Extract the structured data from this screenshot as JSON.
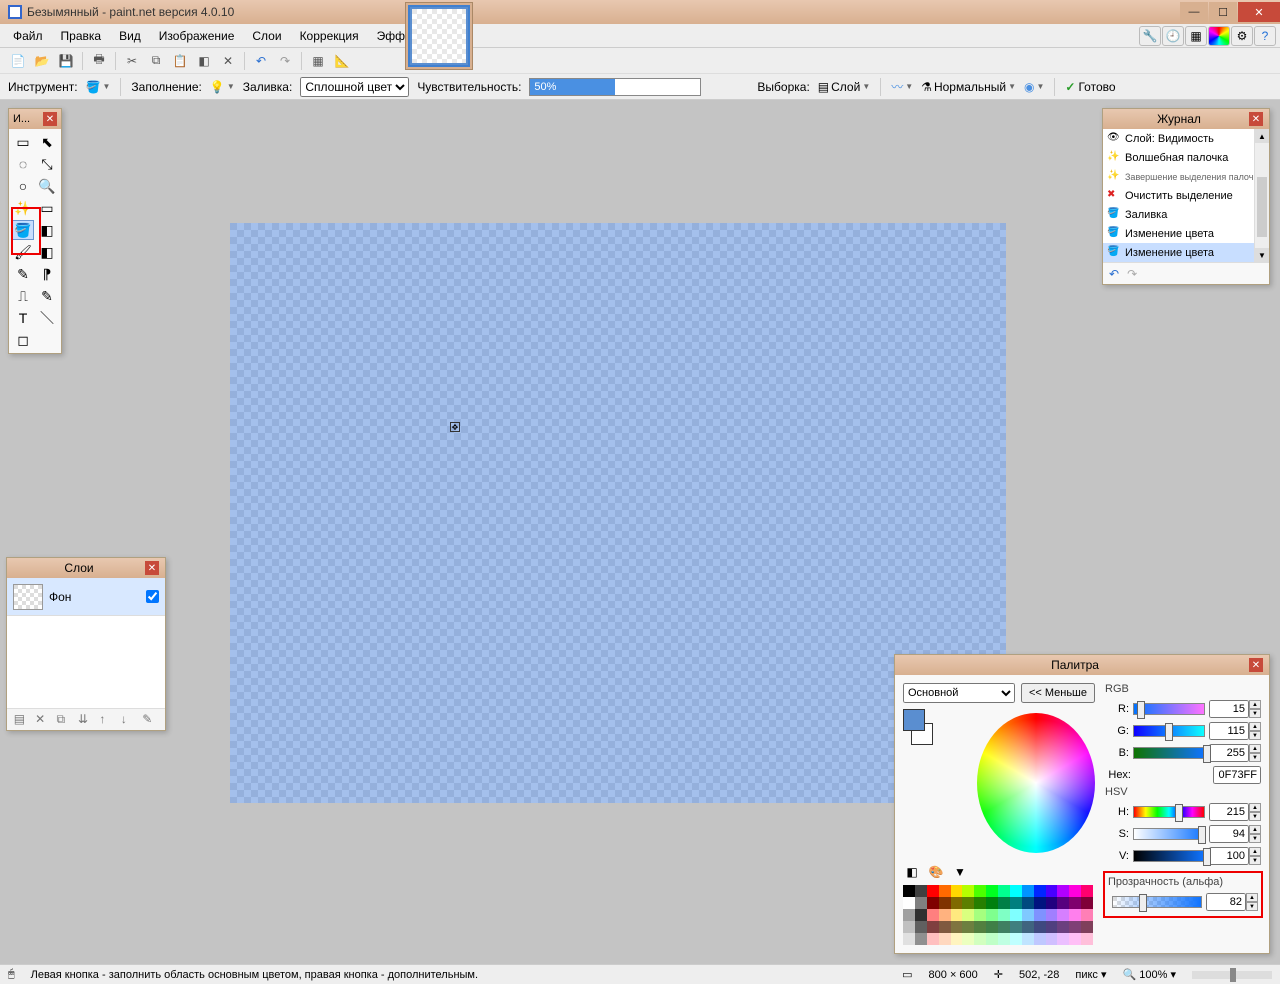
{
  "window": {
    "title": "Безымянный - paint.net версия 4.0.10"
  },
  "menu": {
    "items": [
      "Файл",
      "Правка",
      "Вид",
      "Изображение",
      "Слои",
      "Коррекция",
      "Эффекты"
    ]
  },
  "options": {
    "tool_label": "Инструмент:",
    "fill_label": "Заполнение:",
    "fillmode_label": "Заливка:",
    "fillmode_value": "Сплошной цвет",
    "tolerance_label": "Чувствительность:",
    "tolerance_value": "50%",
    "sampling_label": "Выборка:",
    "sampling_value": "Слой",
    "blend_value": "Нормальный",
    "ready": "Готово"
  },
  "toolwin": {
    "title": "И..."
  },
  "layers": {
    "title": "Слои",
    "items": [
      {
        "name": "Фон",
        "visible": true
      }
    ]
  },
  "history": {
    "title": "Журнал",
    "items": [
      {
        "icon": "eye",
        "text": "Слой: Видимость"
      },
      {
        "icon": "wand",
        "text": "Волшебная палочка"
      },
      {
        "icon": "wand",
        "text": "Завершение выделения палочкой",
        "tiny": true
      },
      {
        "icon": "clear",
        "text": "Очистить выделение"
      },
      {
        "icon": "bucket",
        "text": "Заливка"
      },
      {
        "icon": "bucket",
        "text": "Изменение цвета"
      },
      {
        "icon": "bucket",
        "text": "Изменение цвета",
        "selected": true
      }
    ]
  },
  "palette": {
    "title": "Палитра",
    "color_source": "Основной",
    "less_btn": "<< Меньше",
    "rgb_label": "RGB",
    "r_label": "R:",
    "r_value": "15",
    "g_label": "G:",
    "g_value": "115",
    "b_label": "B:",
    "b_value": "255",
    "hex_label": "Hex:",
    "hex_value": "0F73FF",
    "hsv_label": "HSV",
    "h_label": "H:",
    "h_value": "215",
    "s_label": "S:",
    "s_value": "94",
    "v_label": "V:",
    "v_value": "100",
    "alpha_label": "Прозрачность (альфа)",
    "alpha_value": "82"
  },
  "status": {
    "hint": "Левая кнопка - заполнить область основным цветом, правая кнопка - дополнительным.",
    "dims": "800 × 600",
    "coords": "502, -28",
    "unit": "пикс",
    "zoom": "100%"
  }
}
